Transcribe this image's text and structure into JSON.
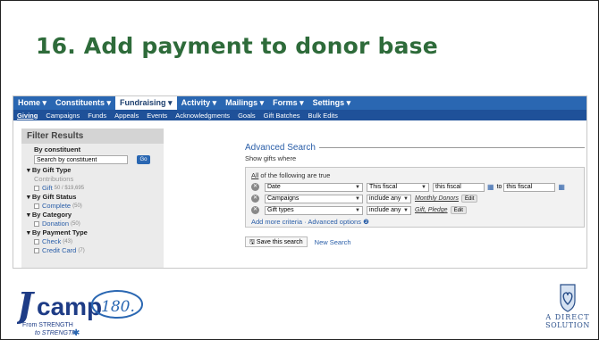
{
  "slide": {
    "title": "16. Add payment to donor base"
  },
  "topnav": [
    {
      "label": "Home ▾",
      "active": false
    },
    {
      "label": "Constituents ▾",
      "active": false
    },
    {
      "label": "Fundraising ▾",
      "active": true
    },
    {
      "label": "Activity ▾",
      "active": false
    },
    {
      "label": "Mailings ▾",
      "active": false
    },
    {
      "label": "Forms ▾",
      "active": false
    },
    {
      "label": "Settings ▾",
      "active": false
    }
  ],
  "subnav": [
    "Giving",
    "Campaigns",
    "Funds",
    "Appeals",
    "Events",
    "Acknowledgments",
    "Goals",
    "Gift Batches",
    "Bulk Edits"
  ],
  "filter": {
    "title": "Filter Results",
    "by_constituent": "By constituent",
    "search_placeholder": "Search by constituent",
    "go": "Go",
    "gift_type": "▾ By Gift Type",
    "contributions": "Contributions",
    "gift": "Gift",
    "gift_count": "50 / $19,695",
    "gift_status": "▾ By Gift Status",
    "complete": "Complete",
    "complete_count": "(50)",
    "category": "▾ By Category",
    "donation": "Donation",
    "donation_count": "(50)",
    "payment_type": "▾ By Payment Type",
    "check": "Check",
    "check_count": "(43)",
    "credit_card": "Credit Card",
    "credit_card_count": "(7)"
  },
  "advanced": {
    "title": "Advanced Search",
    "show": "Show gifts where",
    "all_of_u": "All",
    "all_of_rest": " of the following are true",
    "c1_field": "Date",
    "c1_op": "This fiscal",
    "c1_from": "this fiscal",
    "c1_to_label": "to",
    "c1_to": "this fiscal",
    "c2_field": "Campaigns",
    "c2_op": "include any",
    "c2_value": "Monthly Donors",
    "c3_field": "Gift types",
    "c3_op": "include any",
    "c3_value": "Gift, Pledge",
    "edit": "Edit",
    "more": "Add more criteria · Advanced options ❷",
    "save": "Save this search",
    "new_search": "New Search"
  },
  "logos": {
    "left_main": "camp",
    "left_num": "180.",
    "left_tag1": "From STRENGTH",
    "left_tag2": "to STRENGTH",
    "right_1": "A DIRECT",
    "right_2": "SOLUTION"
  },
  "colors": {
    "title": "#2e6b3a",
    "nav": "#2a67b2",
    "subnav": "#1f5199",
    "link": "#2a5ea8"
  }
}
